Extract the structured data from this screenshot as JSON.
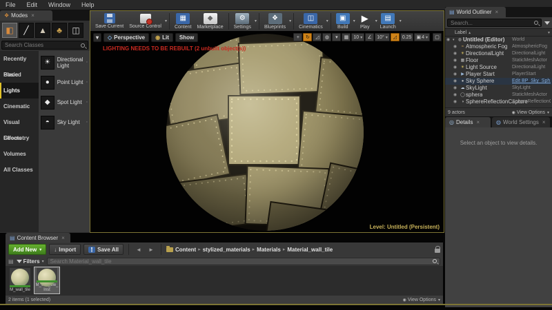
{
  "menu": {
    "items": [
      "File",
      "Edit",
      "Window",
      "Help"
    ]
  },
  "modes": {
    "tab": "Modes",
    "search_placeholder": "Search Classes",
    "categories": [
      "Recently Placed",
      "Basic",
      "Lights",
      "Cinematic",
      "Visual Effects",
      "Geometry",
      "Volumes",
      "All Classes"
    ],
    "selected_category": "Lights",
    "items": [
      {
        "label": "Directional Light",
        "icon": "☀"
      },
      {
        "label": "Point Light",
        "icon": "●"
      },
      {
        "label": "Spot Light",
        "icon": "◆"
      },
      {
        "label": "Sky Light",
        "icon": "◓"
      }
    ]
  },
  "toolbar": {
    "buttons": [
      {
        "label": "Save Current"
      },
      {
        "label": "Source Control"
      },
      {
        "label": "Content"
      },
      {
        "label": "Marketplace"
      },
      {
        "label": "Settings"
      },
      {
        "label": "Blueprints"
      },
      {
        "label": "Cinematics"
      },
      {
        "label": "Build"
      },
      {
        "label": "Play"
      },
      {
        "label": "Launch"
      }
    ]
  },
  "viewport": {
    "nav_label": "Perspective",
    "lit_label": "Lit",
    "show_label": "Show",
    "warning": "LIGHTING NEEDS TO BE REBUILT (2 unbuilt object(s))",
    "level_label": "Level:",
    "level_value": "Untitled (Persistent)",
    "grid_snap": "10",
    "angle_snap": "10°",
    "scale_snap": "0.25",
    "camera_speed": "4"
  },
  "outliner": {
    "tab": "World Outliner",
    "search_placeholder": "Search...",
    "col_label": "Label",
    "col_type": "Type",
    "rows": [
      {
        "label": "Untitled (Editor)",
        "type": "World",
        "icon": "◍"
      },
      {
        "label": "Atmospheric Fog",
        "type": "AtmosphericFog",
        "icon": "≈"
      },
      {
        "label": "DirectionalLight",
        "type": "DirectionalLight",
        "icon": "☀"
      },
      {
        "label": "Floor",
        "type": "StaticMeshActor",
        "icon": "▦"
      },
      {
        "label": "Light Source",
        "type": "DirectionalLight",
        "icon": "☀"
      },
      {
        "label": "Player Start",
        "type": "PlayerStart",
        "icon": "▶"
      },
      {
        "label": "Sky Sphere",
        "type": "Edit BP_Sky_Sph...",
        "icon": "●"
      },
      {
        "label": "SkyLight",
        "type": "SkyLight",
        "icon": "☁"
      },
      {
        "label": "sphera",
        "type": "StaticMeshActor",
        "icon": "◯"
      },
      {
        "label": "SphereReflectionCapture",
        "type": "SphereReflectionC...",
        "icon": "◑"
      }
    ],
    "footer": "9 actors",
    "view_options": "View Options"
  },
  "details": {
    "tab_details": "Details",
    "tab_world_settings": "World Settings",
    "empty_text": "Select an object to view details."
  },
  "content_browser": {
    "tab": "Content Browser",
    "add_new": "Add New",
    "import": "Import",
    "save_all": "Save All",
    "breadcrumbs": [
      "Content",
      "stylized_materials",
      "Materials",
      "Material_wall_tile"
    ],
    "filters": "Filters",
    "search_placeholder": "Search Material_wall_tile",
    "assets": [
      {
        "name": "M_wall_tile",
        "selected": false
      },
      {
        "name": "M_wall_tile_Inst",
        "selected": true
      }
    ],
    "status": "2 items (1 selected)",
    "view_options": "View Options"
  },
  "icons": {
    "dropdown": "▾",
    "crumb_sep": "▸",
    "close": "×",
    "eye": "◉",
    "sun": "☀",
    "grid": "▦",
    "angle": "∠",
    "rotate": "↻",
    "move": "+",
    "scale": "◿",
    "globe": "◍",
    "camera": "▣",
    "maximize": "▢",
    "play_big": "▶",
    "back": "◄",
    "forward": "►",
    "sort_asc": "▴",
    "expand": "▾",
    "modes_tab": "❖",
    "panel_tab": "▤",
    "details_tab": "◎",
    "world_tab": "◍",
    "place_mode": "◧",
    "paint_mode": "╱",
    "landscape_mode": "▲",
    "foliage_mode": "♣",
    "geometry_mode": "◫",
    "content": "▦",
    "marketplace": "◆",
    "settings": "⚙",
    "blueprints": "❖",
    "cinematics": "◫",
    "build": "▣",
    "launch": "▤",
    "import_arrow": "↓",
    "persp": "◇",
    "lit": "◉"
  },
  "colors": {
    "accent_gold": "#7d7535",
    "accent_orange": "#cf8318",
    "warning_red": "#cc2a20",
    "link_blue": "#84aede",
    "add_new_green": "#4f9426",
    "level_text": "#c9b35a"
  }
}
